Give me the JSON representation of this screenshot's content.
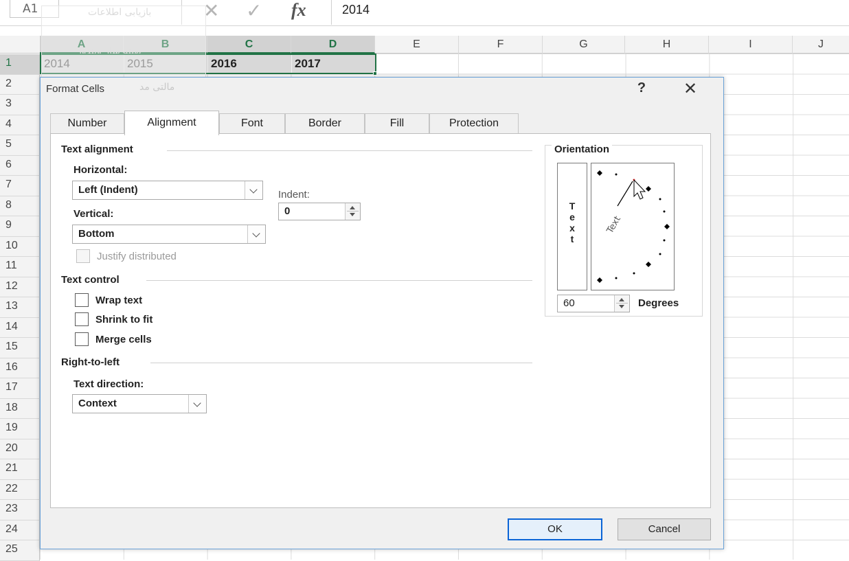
{
  "formula_bar": {
    "name_box": "A1",
    "formula_value": "2014",
    "ghost_data_retrieval": "بازیابی اطلاعات",
    "ghost_optimizer": "بهینه ساز ویندوز",
    "ghost_financial": "مالتی مد"
  },
  "grid": {
    "columns": [
      "A",
      "B",
      "C",
      "D",
      "E",
      "F",
      "G",
      "H",
      "I",
      "J"
    ],
    "rows": [
      "1",
      "2",
      "3",
      "4",
      "5",
      "6",
      "7",
      "8",
      "9",
      "10",
      "11",
      "12",
      "13",
      "14",
      "15",
      "16",
      "17",
      "18",
      "19",
      "20",
      "21",
      "22",
      "23",
      "24",
      "25"
    ],
    "row1_values": [
      "2014",
      "2015",
      "2016",
      "2017"
    ]
  },
  "dialog": {
    "title": "Format Cells",
    "help_label": "?",
    "close_label": "✕",
    "tabs": [
      "Number",
      "Alignment",
      "Font",
      "Border",
      "Fill",
      "Protection"
    ],
    "active_tab": "Alignment",
    "text_alignment": {
      "section": "Text alignment",
      "horizontal_label": "Horizontal:",
      "horizontal_value": "Left (Indent)",
      "vertical_label": "Vertical:",
      "vertical_value": "Bottom",
      "indent_label": "Indent:",
      "indent_value": "0",
      "justify_distributed": "Justify distributed"
    },
    "text_control": {
      "section": "Text control",
      "wrap_text": "Wrap text",
      "shrink_to_fit": "Shrink to fit",
      "merge_cells": "Merge cells"
    },
    "right_to_left": {
      "section": "Right-to-left",
      "direction_label": "Text direction:",
      "direction_value": "Context"
    },
    "orientation": {
      "section": "Orientation",
      "vertical_letters": [
        "T",
        "e",
        "x",
        "t"
      ],
      "dial_text": "Text",
      "degrees_value": "60",
      "degrees_label": "Degrees"
    },
    "buttons": {
      "ok": "OK",
      "cancel": "Cancel"
    }
  },
  "colors": {
    "excel_green": "#217346",
    "dialog_border": "#6aa2d8",
    "default_button_border": "#0a64d6"
  }
}
